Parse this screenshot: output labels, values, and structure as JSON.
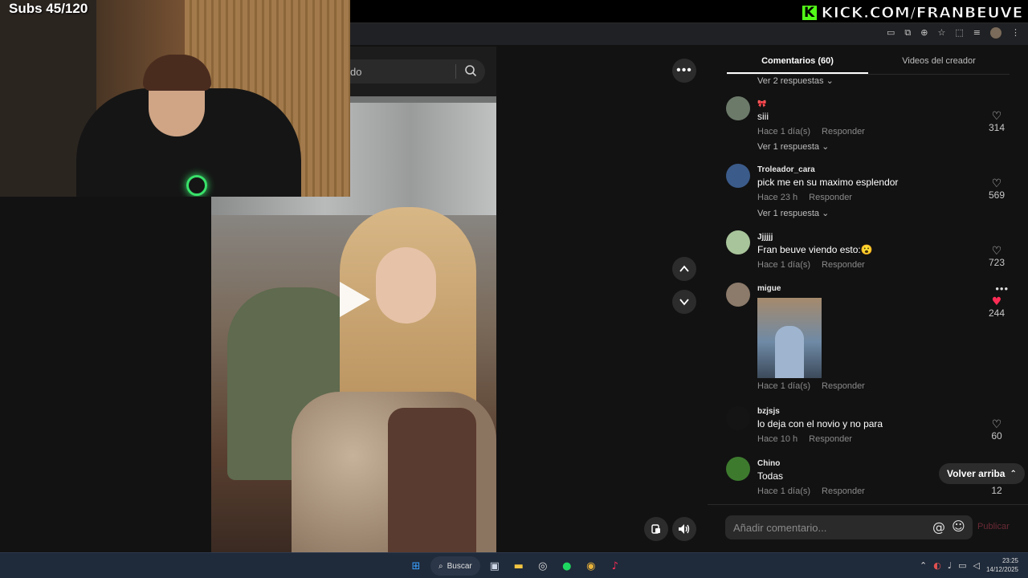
{
  "overlay": {
    "subs": "Subs 45/120",
    "kick_logo": "K",
    "kick_url": "KICK.COM/FRANBEUVE"
  },
  "search": {
    "partial_text": "do"
  },
  "comments_panel": {
    "tabs": [
      {
        "label": "Comentarios (60)",
        "active": true
      },
      {
        "label": "Videos del creador",
        "active": false
      }
    ],
    "top_replies": "Ver 2 respuestas",
    "reply_action": "Responder",
    "comments": [
      {
        "user": "",
        "text": "siii",
        "time": "Hace 1 día(s)",
        "likes": "314",
        "replies": "Ver 1 respuesta",
        "liked": false
      },
      {
        "user": "Troleador_cara",
        "text": "pick me en su maximo esplendor",
        "time": "Hace 23 h",
        "likes": "569",
        "replies": "Ver 1 respuesta",
        "liked": false
      },
      {
        "user": "Jjjjjj",
        "text": "Fran beuve viendo esto:😮",
        "time": "Hace 1 día(s)",
        "likes": "723",
        "liked": false
      },
      {
        "user": "migue",
        "text": "",
        "time": "Hace 1 día(s)",
        "likes": "244",
        "liked": true,
        "has_image": true
      },
      {
        "user": "bzjsjs",
        "text": "lo deja con el novio y no para",
        "time": "Hace 10 h",
        "likes": "60",
        "liked": false
      },
      {
        "user": "Chino",
        "text": "Todas",
        "time": "Hace 1 día(s)",
        "likes": "12",
        "liked": false
      }
    ],
    "back_to_top": "Volver arriba",
    "add_comment_placeholder": "Añadir comentario...",
    "publish": "Publicar"
  },
  "taskbar": {
    "search_label": "Buscar",
    "time": "23:25",
    "date": "14/12/2025"
  },
  "colors": {
    "accent": "#fe2c55",
    "kick_green": "#53fc18"
  }
}
